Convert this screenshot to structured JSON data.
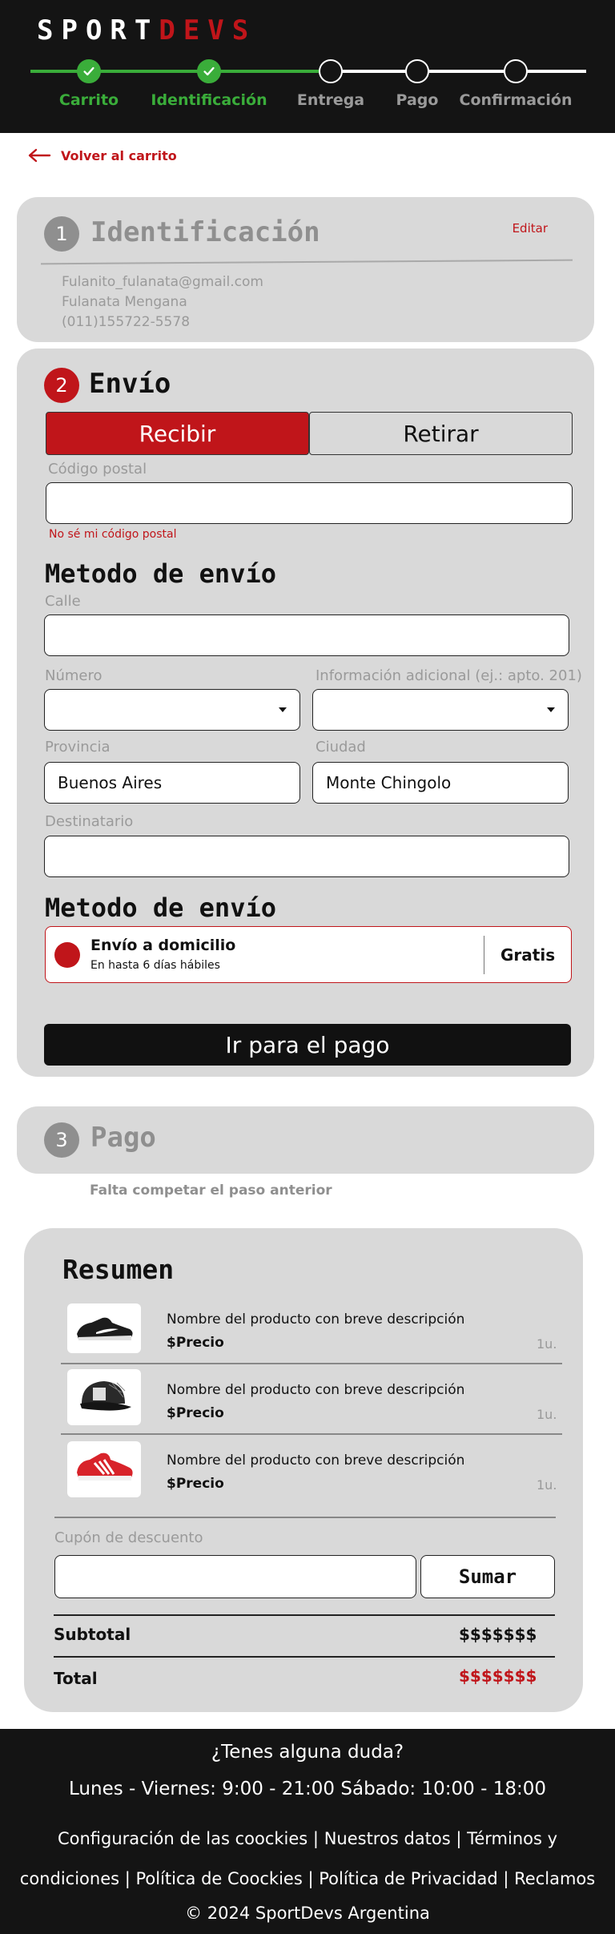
{
  "brand": {
    "logo_white": "SPORT",
    "logo_red": "DEVS"
  },
  "colors": {
    "accent": "#c0151a",
    "success": "#3aad3a",
    "header_bg": "#141414",
    "card_bg": "#d9d9d9"
  },
  "progress": {
    "steps": [
      {
        "label": "Carrito",
        "done": true
      },
      {
        "label": "Identificación",
        "done": true
      },
      {
        "label": "Entrega",
        "done": false
      },
      {
        "label": "Pago",
        "done": false
      },
      {
        "label": "Confirmación",
        "done": false
      }
    ]
  },
  "back_link": "Volver al carrito",
  "identification": {
    "number": "1",
    "title": "Identificación",
    "edit": "Editar",
    "email": "Fulanito_fulanata@gmail.com",
    "name": "Fulanata Mengana",
    "phone": "(011)155722-5578"
  },
  "shipping": {
    "number": "2",
    "title": "Envío",
    "toggle_receive": "Recibir",
    "toggle_pickup": "Retirar",
    "postal_label": "Código postal",
    "postal_value": "",
    "postal_help": "No sé mi código postal",
    "method_title": "Metodo de envío",
    "street_label": "Calle",
    "street_value": "",
    "number_label": "Número",
    "number_value": "",
    "extra_label": "Información adicional (ej.: apto. 201)",
    "extra_value": "",
    "province_label": "Provincia",
    "province_value": "Buenos Aires",
    "city_label": "Ciudad",
    "city_value": "Monte Chingolo",
    "recipient_label": "Destinatario",
    "recipient_value": "",
    "method_title_2": "Metodo de envío",
    "option_name": "Envío a domicilio",
    "option_eta": "En hasta 6 días hábiles",
    "option_price": "Gratis",
    "pay_button": "Ir para el pago"
  },
  "payment": {
    "number": "3",
    "title": "Pago",
    "missing": "Falta competar el paso anterior"
  },
  "summary": {
    "title": "Resumen",
    "products": [
      {
        "name": "Nombre del producto con breve descripción",
        "price": "$Precio",
        "qty": "1u.",
        "icon": "black-sneaker-icon"
      },
      {
        "name": "Nombre del producto con breve descripción",
        "price": "$Precio",
        "qty": "1u.",
        "icon": "cap-icon"
      },
      {
        "name": "Nombre del producto con breve descripción",
        "price": "$Precio",
        "qty": "1u.",
        "icon": "red-sneaker-icon"
      }
    ],
    "coupon_label": "Cupón de descuento",
    "coupon_value": "",
    "coupon_button": "Sumar",
    "subtotal_label": "Subtotal",
    "subtotal_value": "$$$$$$$",
    "total_label": "Total",
    "total_value": "$$$$$$$"
  },
  "footer": {
    "question": "¿Tenes alguna duda?",
    "hours": "Lunes - Viernes: 9:00 - 21:00 Sábado: 10:00 - 18:00",
    "links": [
      "Configuración de las coockies",
      "Nuestros datos",
      "Términos y condiciones",
      "Política de Coockies",
      "Política de Privacidad",
      "Reclamos"
    ],
    "copyright": "©  2024  SportDevs Argentina"
  }
}
